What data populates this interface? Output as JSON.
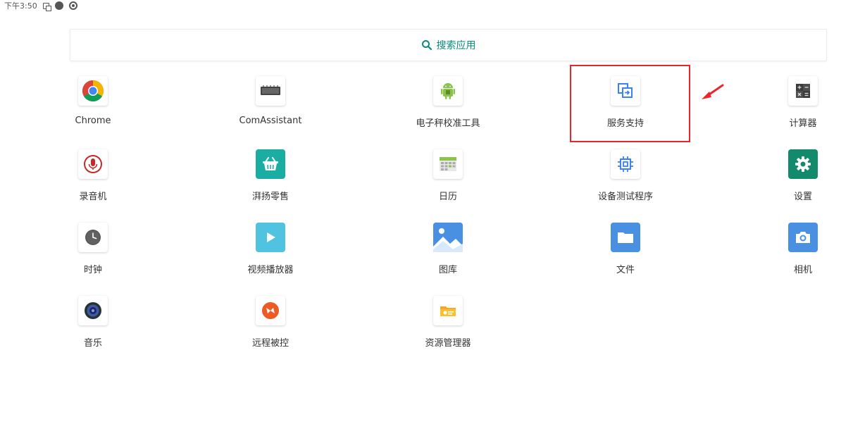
{
  "status_bar": {
    "time": "下午3:50"
  },
  "search": {
    "label": "搜索应用"
  },
  "apps": [
    {
      "label": "Chrome"
    },
    {
      "label": "ComAssistant"
    },
    {
      "label": "电子秤校准工具"
    },
    {
      "label": "服务支持"
    },
    {
      "label": "计算器"
    },
    {
      "label": "录音机"
    },
    {
      "label": "湃扬零售"
    },
    {
      "label": "日历"
    },
    {
      "label": "设备测试程序"
    },
    {
      "label": "设置"
    },
    {
      "label": "时钟"
    },
    {
      "label": "视频播放器"
    },
    {
      "label": "图库"
    },
    {
      "label": "文件"
    },
    {
      "label": "相机"
    },
    {
      "label": "音乐"
    },
    {
      "label": "远程被控"
    },
    {
      "label": "资源管理器"
    }
  ],
  "colors": {
    "accent": "#0a8a7a",
    "highlight": "#e8262b"
  }
}
